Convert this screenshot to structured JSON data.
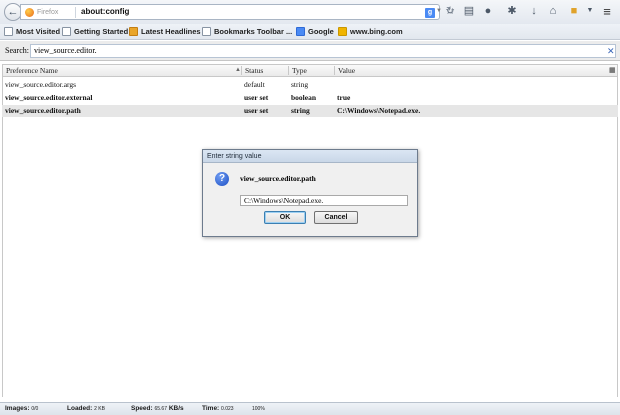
{
  "nav": {
    "back_glyph": "←",
    "identity_label": "Firefox",
    "url": "about:config",
    "search_engine_icon": "google-g-icon",
    "reload_glyph": "↻",
    "toolbar_icons": [
      "star-icon",
      "reading-list-icon",
      "extension-icon",
      "translate-icon",
      "download-icon",
      "home-icon",
      "folder-icon",
      "overflow-icon"
    ],
    "menu_glyph": "≡"
  },
  "bookmarks": [
    {
      "label": "Most Visited",
      "icon": "bookmark-folder-icon"
    },
    {
      "label": "Getting Started",
      "icon": "page-icon"
    },
    {
      "label": "Latest Headlines",
      "icon": "rss-icon"
    },
    {
      "label": "Bookmarks Toolbar ...",
      "icon": "page-icon"
    },
    {
      "label": "Google",
      "icon": "google-icon"
    },
    {
      "label": "www.bing.com",
      "icon": "bing-icon"
    }
  ],
  "search": {
    "label": "Search:",
    "value": "view_source.editor.",
    "clear_glyph": "✕"
  },
  "table": {
    "columns": [
      "Preference Name",
      "Status",
      "Type",
      "Value"
    ],
    "rows": [
      {
        "name": "view_source.editor.args",
        "status": "default",
        "type": "string",
        "value": "",
        "bold": false,
        "selected": false
      },
      {
        "name": "view_source.editor.external",
        "status": "user set",
        "type": "boolean",
        "value": "true",
        "bold": true,
        "selected": false
      },
      {
        "name": "view_source.editor.path",
        "status": "user set",
        "type": "string",
        "value": "C:\\Windows\\Notepad.exe.",
        "bold": true,
        "selected": true
      }
    ]
  },
  "dialog": {
    "title": "Enter string value",
    "message": "view_source.editor.path",
    "input_value": "C:\\Windows\\Notepad.exe.",
    "ok_label": "OK",
    "cancel_label": "Cancel",
    "icon": "question-icon"
  },
  "status": {
    "images_label": "Images:",
    "images_value": "0/0",
    "loaded_label": "Loaded:",
    "loaded_value": "2 KB",
    "speed_label": "Speed:",
    "speed_value": "65.67",
    "speed_unit": "KB/s",
    "time_label": "Time:",
    "time_value": "0.023",
    "percent": "100%"
  }
}
